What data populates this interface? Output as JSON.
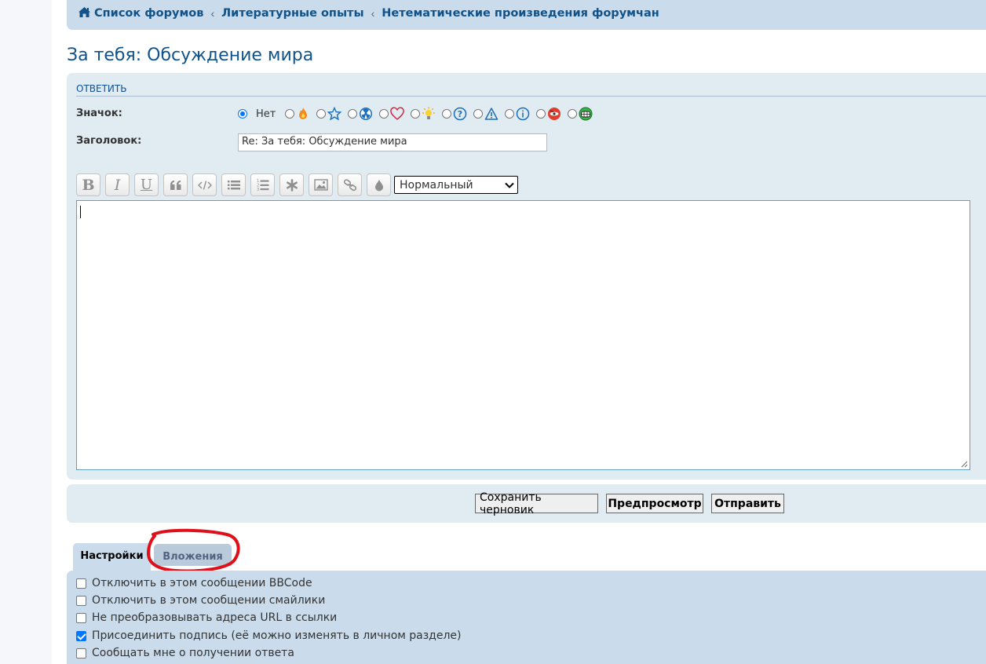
{
  "breadcrumb": {
    "items": [
      "Список форумов",
      "Литературные опыты",
      "Нетематические произведения форумчан"
    ],
    "separator": "‹"
  },
  "topic": {
    "title": "За тебя: Обсуждение мира"
  },
  "post_form": {
    "header": "ОТВЕТИТЬ",
    "icon_label": "Значок:",
    "icon_none_label": "Нет",
    "icon_selected": "none",
    "icons": [
      "fire-icon",
      "star-icon",
      "radioactive-icon",
      "heart-icon",
      "lightbulb-icon",
      "question-icon",
      "warning-icon",
      "info-icon",
      "mad-face-icon",
      "grin-face-icon"
    ],
    "subject_label": "Заголовок:",
    "subject_value": "Re: За тебя: Обсуждение мира",
    "toolbar": {
      "bold": "B",
      "italic": "I",
      "underline": "U",
      "font_size_value": "Нормальный"
    },
    "message_value": ""
  },
  "buttons": {
    "save_draft": "Сохранить черновик",
    "preview": "Предпросмотр",
    "submit": "Отправить"
  },
  "tabs": {
    "options": "Настройки",
    "attachments": "Вложения",
    "active": "options"
  },
  "options": [
    {
      "label": "Отключить в этом сообщении BBCode",
      "checked": false
    },
    {
      "label": "Отключить в этом сообщении смайлики",
      "checked": false
    },
    {
      "label": "Не преобразовывать адреса URL в ссылки",
      "checked": false
    },
    {
      "label": "Присоединить подпись (её можно изменять в личном разделе)",
      "checked": true
    },
    {
      "label": "Сообщать мне о получении ответа",
      "checked": false
    }
  ],
  "colors": {
    "link": "#105289",
    "panel": "#e1ebf2",
    "panel_dark": "#cadceb",
    "annotation_red": "#e0101a"
  }
}
